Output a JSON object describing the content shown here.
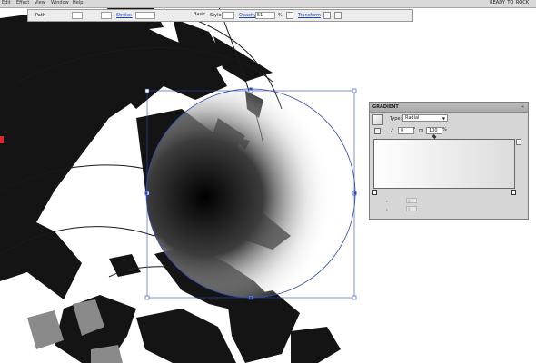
{
  "menu": {
    "items": [
      "Edit",
      "Effect",
      "View",
      "Window",
      "Help"
    ],
    "document_name": "READY_TO_ROCK"
  },
  "control_bar": {
    "selection_type": "Path",
    "stroke_label": "Stroke:",
    "stroke_value": "",
    "brush_label": "Basic",
    "style_label": "Style:",
    "opacity_label": "Opacity:",
    "opacity_value": "51",
    "opacity_unit": "%",
    "transform_label": "Transform"
  },
  "gradient_panel": {
    "title": "GRADIENT",
    "close": "«",
    "type_label": "Type:",
    "type_value": "Radial",
    "angle_value": "0",
    "angle_unit": "°",
    "aspect_value": "100",
    "aspect_unit": "%",
    "stop_location": "0",
    "stop_opacity": "0",
    "ramp_colors": [
      "#ffffff",
      "#dcdcdc"
    ]
  },
  "colors": {
    "selection_blue": "#3049b5",
    "artwork_dark": "#151515"
  },
  "icons": [
    "selection-bounding-box",
    "gradient-ellipse",
    "trash-icon",
    "reverse-gradient-icon"
  ]
}
